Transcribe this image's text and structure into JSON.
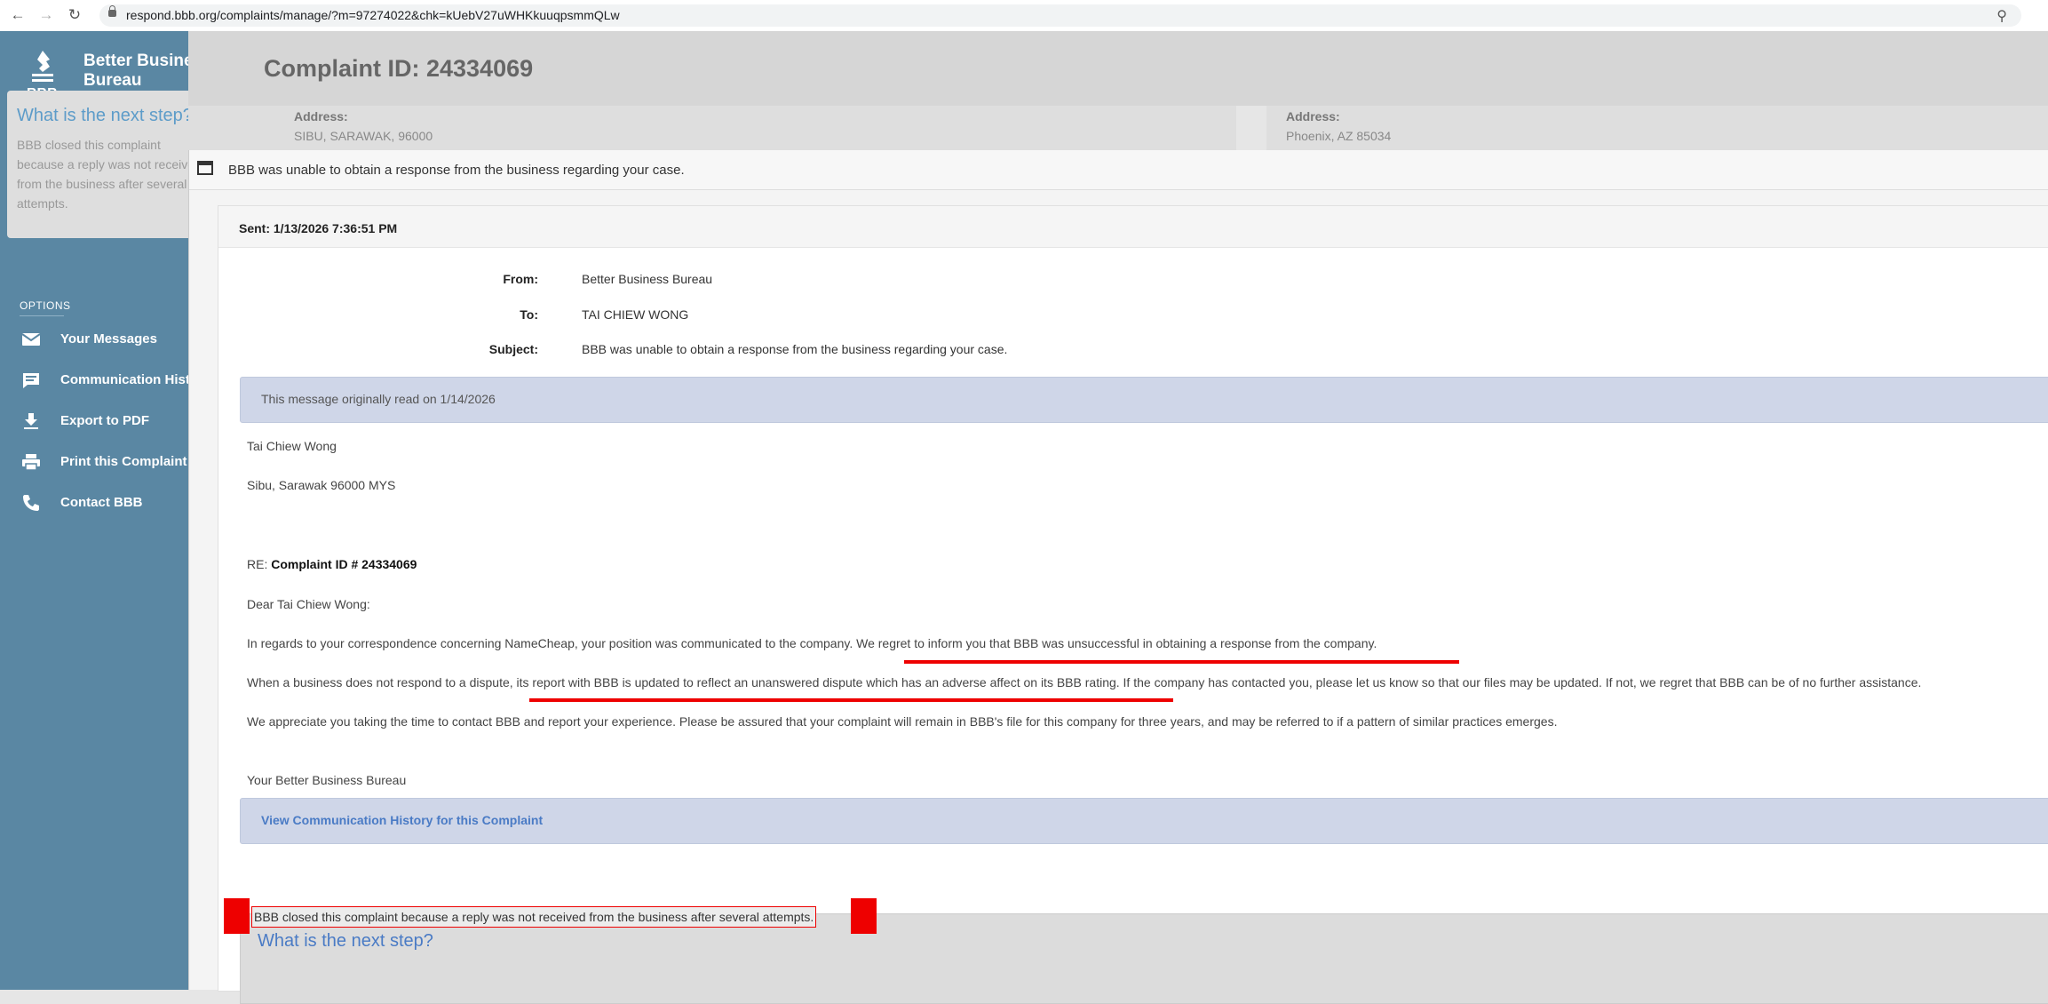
{
  "browser": {
    "url": "respond.bbb.org/complaints/manage/?m=97274022&chk=kUebV27uWHKkuuqpsmmQLw"
  },
  "sidebar": {
    "brand": "Better Business Bureau",
    "logo_text": "BBB",
    "next_step_title": "What is the next step?",
    "next_step_text": "BBB closed this complaint because a reply was not received from the business after several attempts.",
    "options_label": "OPTIONS",
    "items": [
      {
        "label": "Your Messages",
        "icon": "mail-icon"
      },
      {
        "label": "Communication History",
        "icon": "chat-icon"
      },
      {
        "label": "Export to PDF",
        "icon": "download-icon"
      },
      {
        "label": "Print this Complaint",
        "icon": "print-icon"
      },
      {
        "label": "Contact BBB",
        "icon": "phone-icon"
      }
    ]
  },
  "header": {
    "complaint_id": "Complaint ID: 24334069",
    "left_address_label": "Address:",
    "left_address": "SIBU, SARAWAK, 96000",
    "right_address_label": "Address:",
    "right_address": "Phoenix, AZ 85034"
  },
  "modal": {
    "title": "BBB was unable to obtain a response from the business regarding your case.",
    "sent": "Sent: 1/13/2026 7:36:51 PM",
    "from_label": "From:",
    "from": "Better Business Bureau",
    "to_label": "To:",
    "to": "TAI CHIEW WONG",
    "subject_label": "Subject:",
    "subject": "BBB was unable to obtain a response from the business regarding your case.",
    "read_notice": "This message originally read on 1/14/2026",
    "recipient_name": "Tai Chiew Wong",
    "recipient_address": "Sibu, Sarawak 96000 MYS",
    "re_prefix": "RE:",
    "re_id": "Complaint ID #  24334069",
    "salutation": "Dear Tai Chiew Wong:",
    "para1": "In regards to your correspondence concerning NameCheap, your position was communicated to the company. We regret to inform you that BBB was unsuccessful in obtaining a response from the company.",
    "para2": "When a business does not respond to a dispute, its report with BBB is updated to reflect an unanswered dispute which has an adverse affect on its BBB rating. If the company has contacted you, please let us know so that our files may be updated. If not, we regret that BBB can be of no further assistance.",
    "para3": "We appreciate you taking the time to contact BBB and report your experience. Please be assured that your complaint will remain in BBB's file for this company for three years, and may be referred to if a pattern of similar practices emerges.",
    "signoff": "Your Better Business Bureau",
    "history_link": "View Communication History for this Complaint",
    "next_step_title": "What is the next step?",
    "next_step_text": "BBB closed this complaint because a reply was not received from the business after several attempts."
  },
  "colors": {
    "sidebar": "#5a87a3",
    "annotation_red": "#ee0000",
    "link_blue": "#4a7bc5"
  }
}
